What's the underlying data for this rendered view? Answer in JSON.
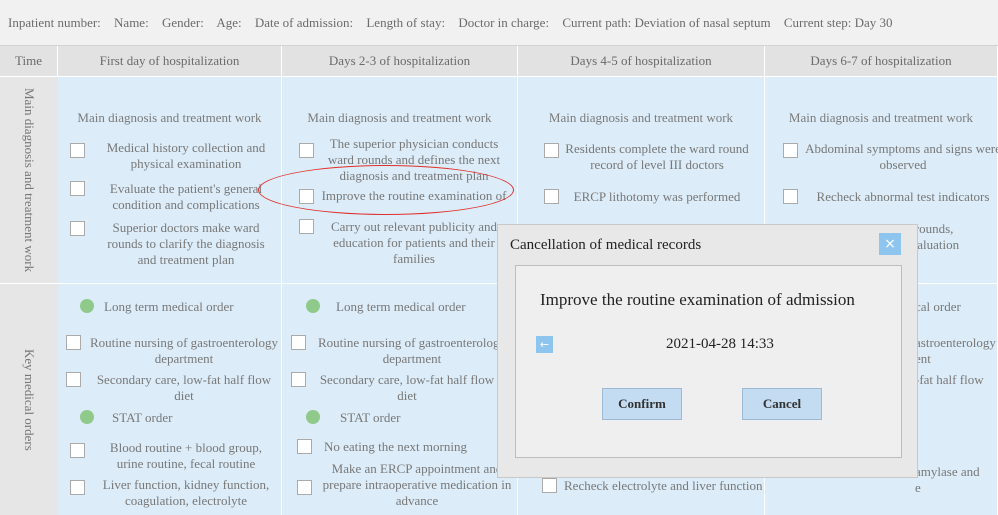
{
  "header": {
    "inpatient_number": "Inpatient number:",
    "name": "Name:",
    "gender": "Gender:",
    "age": "Age:",
    "date_of_admission": "Date of admission:",
    "length_of_stay": "Length of stay:",
    "doctor_in_charge": "Doctor in charge:",
    "current_path": "Current path: Deviation of nasal septum",
    "current_step": "Current step: Day 30"
  },
  "columns": [
    "Time",
    "First day of hospitalization",
    "Days 2-3 of hospitalization",
    "Days 4-5 of hospitalization",
    "Days 6-7 of hospitalization"
  ],
  "rows": {
    "diagnosis_label": "Main diagnosis and treatment work",
    "orders_label": "Key medical orders"
  },
  "diagnosis": {
    "title": "Main diagnosis and treatment work",
    "col1": [
      "Medical history collection and physical examination",
      "Evaluate the patient's general condition and complications",
      "Superior doctors make ward rounds to clarify the diagnosis and treatment plan"
    ],
    "col2": [
      "The superior physician conducts ward rounds and defines the next diagnosis and treatment plan",
      "Improve the routine examination of admission",
      "Carry out relevant publicity and education for patients and their families"
    ],
    "col3": [
      "Residents complete the ward round record of level III doctors",
      "ERCP lithotomy was performed"
    ],
    "col4": [
      "Abdominal symptoms and signs were observed",
      "Recheck abnormal test indicators",
      "n rounds,",
      "evaluation"
    ]
  },
  "orders": {
    "long_term": "Long term medical order",
    "stat": "STAT order",
    "col1": [
      "Routine nursing of gastroenterology department",
      "Secondary care, low-fat half flow diet",
      "Blood routine + blood group, urine routine, fecal routine",
      "Liver function, kidney function, coagulation, electrolyte"
    ],
    "col2": [
      "Routine nursing of gastroenterology department",
      "Secondary care, low-fat half flow diet",
      "No eating the next morning",
      "Make an ERCP appointment and prepare intraoperative medication in advance"
    ],
    "col3": [
      "Recheck electrolyte and liver function"
    ],
    "col4": [
      "cal order",
      "astroenterology",
      "ent",
      "-fat half flow",
      "amylase and",
      "e"
    ]
  },
  "modal": {
    "title": "Cancellation of medical records",
    "close": "×",
    "text": "Improve the routine examination of admission",
    "back": "←",
    "time": "2021-04-28 14:33",
    "confirm": "Confirm",
    "cancel": "Cancel"
  },
  "colors": {
    "cell_bg": "#dcecf8",
    "highlight": "#e0302a",
    "button": "#c3dcf1",
    "close_btn": "#8ec5ee",
    "dot": "#8fca8a"
  }
}
